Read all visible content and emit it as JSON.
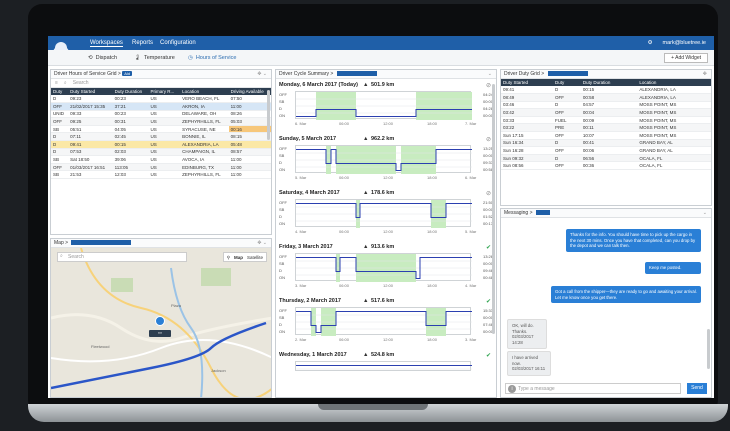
{
  "header": {
    "nav": [
      "Workspaces",
      "Reports",
      "Configuration"
    ],
    "user": "mark@bluetree.ie",
    "tabs": [
      "Dispatch",
      "Temperature",
      "Hours of Service"
    ],
    "add_widget": "+ Add Widget"
  },
  "hos_grid": {
    "title": "Driver Hours of Service Grid >",
    "badge": "Ald",
    "search_placeholder": "Search",
    "columns": [
      "Duty",
      "Duty Started",
      "Duty Duration",
      "Primary R...",
      "Location",
      "Driving Available"
    ],
    "rows": [
      [
        "D",
        "09:23",
        "00:23",
        "US",
        "VERO BEACH, FL",
        "07:50"
      ],
      [
        "OFF",
        "21/02/2017 15:35",
        "37:21",
        "US",
        "AKRON, IA",
        "11:00"
      ],
      [
        "UNID",
        "09:33",
        "00:23",
        "US",
        "DELAWARE, OH",
        "08:26"
      ],
      [
        "OFF",
        "09:25",
        "00:31",
        "US",
        "ZEPHYRHILLS, FL",
        "05:03"
      ],
      [
        "SB",
        "05:51",
        "04:05",
        "US",
        "SYRACUSE, NE",
        "00:16"
      ],
      [
        "D",
        "07:11",
        "02:45",
        "US",
        "BONNIE, IL",
        "08:15"
      ],
      [
        "D",
        "09:41",
        "00:15",
        "US",
        "ALEXANDRIA, LA",
        "05:48"
      ],
      [
        "D",
        "07:53",
        "02:03",
        "US",
        "CHAMPAIGN, IL",
        "08:57"
      ],
      [
        "SB",
        "Sat 18:50",
        "39:06",
        "US",
        "AVOCA, IA",
        "11:00"
      ],
      [
        "OFF",
        "01/03/2017 16:51",
        "113:05",
        "US",
        "EDINBURG, TX",
        "11:00"
      ],
      [
        "SB",
        "21:53",
        "12:03",
        "US",
        "ZEPHYRHILLS, FL",
        "11:00"
      ]
    ]
  },
  "map": {
    "title": "Map >",
    "search_placeholder": "Search",
    "type_options": [
      "Map",
      "Satellite"
    ],
    "places": [
      "Fleetwood",
      "Plaza",
      "Jackson"
    ]
  },
  "cycle_summary": {
    "title": "Driver Cycle Summary >",
    "row_labels": [
      "OFF",
      "SB",
      "D",
      "ON"
    ],
    "axis_labels": [
      "00:00",
      "06:00",
      "12:00",
      "18:00"
    ],
    "days": [
      {
        "date": "Monday, 6 March 2017 (Today)",
        "km": "501.9 km",
        "start": "6. Mar",
        "end": "7. Mar",
        "totals": [
          "04:24",
          "00:00",
          "04:28",
          "00:00"
        ],
        "ok": false
      },
      {
        "date": "Sunday, 5 March 2017",
        "km": "962.2 km",
        "start": "5. Mar",
        "end": "6. Mar",
        "totals": [
          "13:25",
          "00:00",
          "09:37",
          "00:58"
        ],
        "ok": false
      },
      {
        "date": "Saturday, 4 March 2017",
        "km": "178.6 km",
        "start": "4. Mar",
        "end": "5. Mar",
        "totals": [
          "21:50",
          "00:00",
          "01:52",
          "00:17"
        ],
        "ok": false
      },
      {
        "date": "Friday, 3 March 2017",
        "km": "913.6 km",
        "start": "3. Mar",
        "end": "4. Mar",
        "totals": [
          "13:26",
          "00:00",
          "09:46",
          "00:48"
        ],
        "ok": true
      },
      {
        "date": "Thursday, 2 March 2017",
        "km": "517.6 km",
        "start": "2. Mar",
        "end": "3. Mar",
        "totals": [
          "15:33",
          "00:00",
          "07:46",
          "00:00"
        ],
        "ok": true
      },
      {
        "date": "Wednesday, 1 March 2017",
        "km": "524.8 km",
        "start": "",
        "end": "",
        "totals": [
          "",
          "",
          "",
          ""
        ],
        "ok": true
      }
    ]
  },
  "duty_grid": {
    "title": "Driver Duty Grid >",
    "columns": [
      "Duty Started",
      "Duty",
      "Duty Duration",
      "Location"
    ],
    "rows": [
      [
        "09:41",
        "D",
        "00:15",
        "ALEXANDRIA, LA"
      ],
      [
        "08:49",
        "OFF",
        "00:58",
        "ALEXANDRIA, LA"
      ],
      [
        "03:46",
        "D",
        "04:57",
        "MOSS POINT, MS"
      ],
      [
        "03:42",
        "OFF",
        "00:04",
        "MOSS POINT, MS"
      ],
      [
        "03:33",
        "FUEL",
        "00:09",
        "MOSS POINT, MS"
      ],
      [
        "03:22",
        "PRE",
        "00:11",
        "MOSS POINT, MS"
      ],
      [
        "Sun 17:15",
        "OFF",
        "10:07",
        "MOSS POINT, MS"
      ],
      [
        "Sun 16:34",
        "D",
        "00:41",
        "GRAND BAY, AL"
      ],
      [
        "Sun 16:28",
        "OFF",
        "00:06",
        "GRAND BAY, AL"
      ],
      [
        "Sun 09:32",
        "D",
        "06:56",
        "OCALA, FL"
      ],
      [
        "Sun 08:56",
        "OFF",
        "00:36",
        "OCALA, FL"
      ]
    ]
  },
  "messaging": {
    "title": "Messaging >",
    "messages": [
      {
        "dir": "out",
        "text": "Thanks for the info. You should  have time to pick up the cargo in the next 30 mins. Once you have that completed, can you drop by the depot and we can talk then."
      },
      {
        "dir": "out",
        "text": "Keep me posted."
      },
      {
        "dir": "out",
        "text": "Got a call from the shipper—they are ready to go and awaiting your arrival. Let me know once you get there."
      },
      {
        "dir": "in",
        "text": "OK, will do. Thanks.",
        "time": "02/03/2017 14:28"
      },
      {
        "dir": "in",
        "text": "I have arrived now.",
        "time": "02/03/2017 16:11"
      }
    ],
    "input_placeholder": "Type a message",
    "send_label": "Send"
  },
  "colors": {
    "accent": "#1f5fa8",
    "table_head": "#2d3e50",
    "warn_row": "#fbe8a6",
    "driving_fill": "#c8ecc0",
    "duty_line": "#2b3fb0"
  }
}
